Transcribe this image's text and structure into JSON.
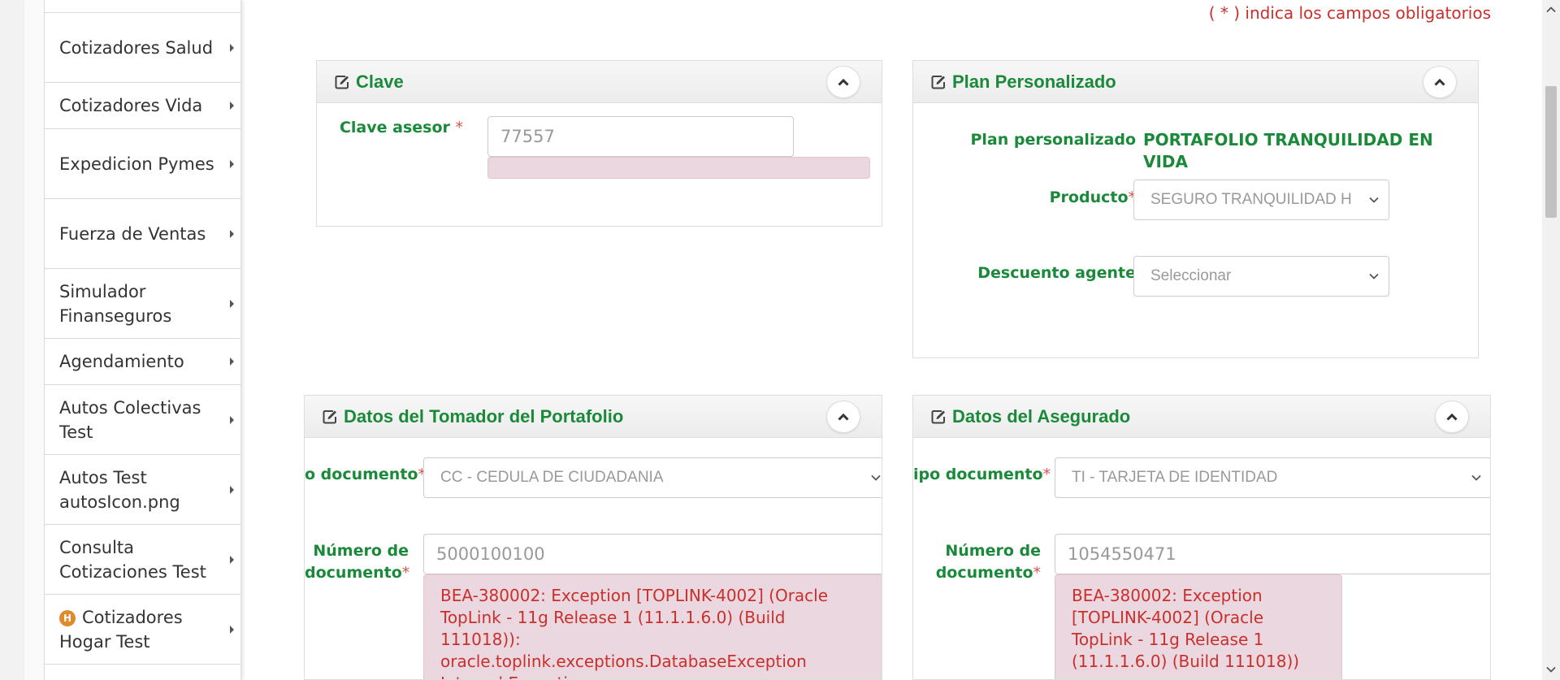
{
  "sidebar": {
    "items": [
      {
        "label": "Cotizadores Salud"
      },
      {
        "label": "Cotizadores Vida"
      },
      {
        "label": "Expedicion Pymes"
      },
      {
        "label": "Fuerza de Ventas"
      },
      {
        "label": "Simulador Finanseguros"
      },
      {
        "label": "Agendamiento"
      },
      {
        "label": "Autos Colectivas Test"
      },
      {
        "label": "Autos Test autosIcon.png"
      },
      {
        "label": "Consulta Cotizaciones Test"
      },
      {
        "label": "Cotizadores Hogar Test",
        "badge": "H"
      }
    ]
  },
  "required_note": "( * ) indica los campos obligatorios",
  "clave": {
    "title": "Clave",
    "asesor_label": "Clave asesor",
    "required_mark": "*",
    "asesor_value": "77557"
  },
  "plan": {
    "title": "Plan Personalizado",
    "plan_label": "Plan personalizado",
    "plan_value": "PORTAFOLIO TRANQUILIDAD EN VIDA",
    "producto_label": "Producto",
    "producto_value": "SEGURO TRANQUILIDAD H",
    "descuento_label": "Descuento agente",
    "descuento_value": "Seleccionar",
    "required_mark": "*"
  },
  "tomador": {
    "title": "Datos del Tomador del Portafolio",
    "tipo_label": "o documento",
    "tipo_value": "CC - CEDULA DE CIUDADANIA",
    "numero_label": "Número de documento",
    "numero_value": "5000100100",
    "error": "BEA-380002: Exception [TOPLINK-4002] (Oracle TopLink - 11g Release 1 (11.1.1.6.0) (Build 111018)): oracle.toplink.exceptions.DatabaseException Internal Exception",
    "required_mark": "*"
  },
  "asegurado": {
    "title": "Datos del Asegurado",
    "tipo_label": "ipo documento",
    "tipo_value": "TI - TARJETA DE IDENTIDAD",
    "numero_label": "Número de documento",
    "numero_value": "1054550471",
    "error": "BEA-380002: Exception [TOPLINK-4002] (Oracle TopLink - 11g Release 1 (11.1.1.6.0) (Build 111018))",
    "required_mark": "*"
  },
  "colors": {
    "accent_green": "#1a8a3a",
    "required_red": "#c9302c",
    "error_bg": "#ead7df"
  }
}
